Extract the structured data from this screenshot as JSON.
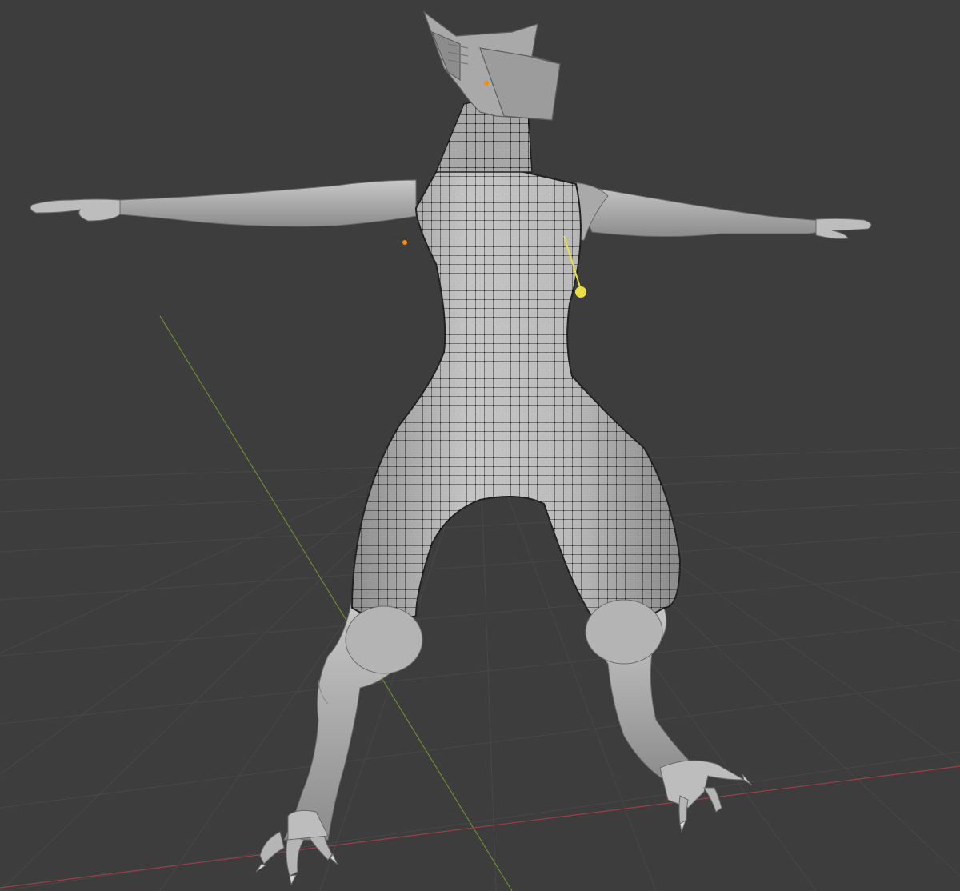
{
  "viewport": {
    "mode": "3d-viewport",
    "background_color": "#3d3d3d",
    "grid_color": "#4a4a4a",
    "x_axis_color": "#9a3f48",
    "y_axis_color": "#6b8a32",
    "mesh_color": "#bdbdbd",
    "wire_color": "#101010",
    "light_color": "#e8e040",
    "origin_color": "#ff8a00"
  },
  "scene": {
    "objects": [
      {
        "name_icon": "character-body-mesh",
        "selected": true,
        "show_wireframe": true
      },
      {
        "name_icon": "helmet-mesh",
        "selected": false
      },
      {
        "name_icon": "light-gizmo"
      }
    ]
  }
}
